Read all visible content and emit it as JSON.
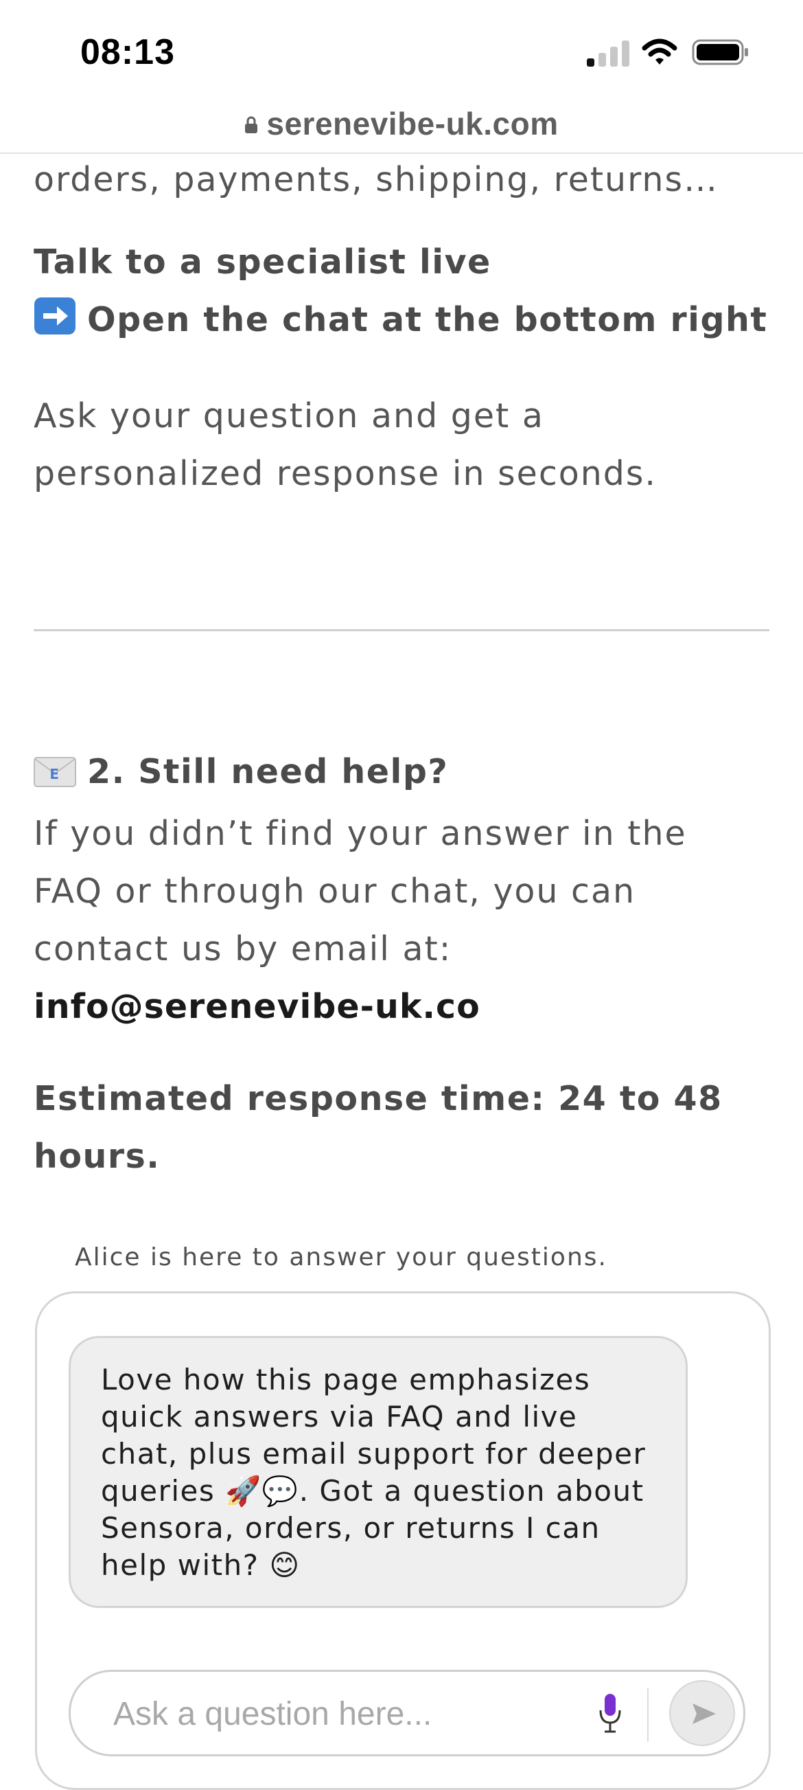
{
  "status_bar": {
    "time": "08:13",
    "icons": [
      "signal-icon",
      "wifi-icon",
      "battery-icon"
    ]
  },
  "browser": {
    "url": "serenevibe-uk.com",
    "icons": [
      "lock-icon"
    ]
  },
  "content": {
    "top_line": "orders, payments, shipping, returns…",
    "live_heading": "Talk to a specialist live",
    "live_cta_emoji": "➡️",
    "live_cta": "Open the chat at the bottom right",
    "live_body_line1": "Ask your question and get a",
    "live_body_line2": "personalized response in seconds.",
    "section2_emoji": "📧",
    "section2_heading": "2. Still need help?",
    "section2_body_line1": "If you didn’t find your answer in the",
    "section2_body_line2": "FAQ or through our chat, you can",
    "section2_body_line3": "contact us by email at:",
    "section2_email": "info@serenevibe-uk.co",
    "response_time_line1": "Estimated response time: 24 to 48",
    "response_time_line2": "hours."
  },
  "chat": {
    "caption": "Alice is here to answer your questions.",
    "message": "Love how this page emphasizes quick answers via FAQ and live chat, plus email support for deeper queries 🚀💬. Got a question about Sensora, orders, or returns I can help with? 😊",
    "input_placeholder": "Ask a question here...",
    "input_value": "",
    "icons": [
      "mic-icon",
      "send-icon"
    ]
  },
  "colors": {
    "body_text": "#555555",
    "heading_text": "#4a4a4a",
    "email_text": "#1a1a1a",
    "bubble_bg": "#efefef",
    "mic_accent": "#7a2fd0"
  }
}
